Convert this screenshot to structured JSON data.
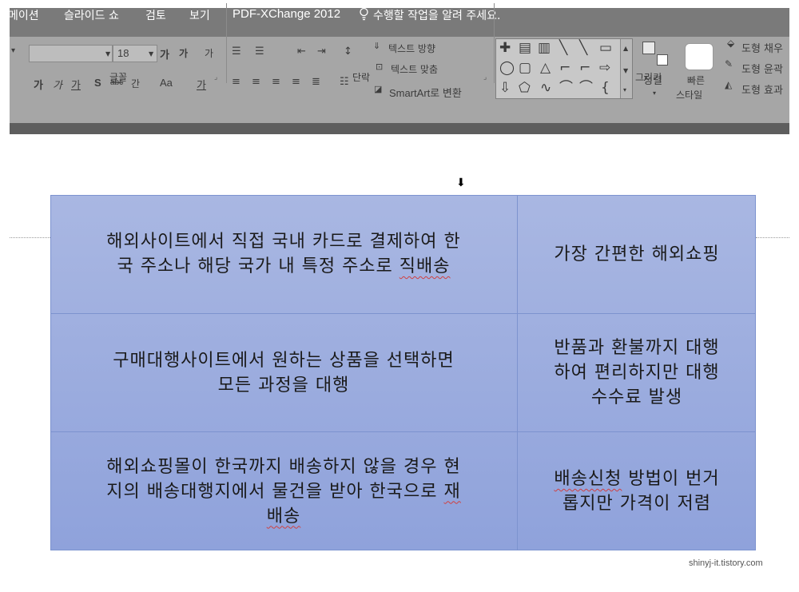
{
  "menu": {
    "tabs": [
      {
        "label": "메이션"
      },
      {
        "label": "슬라이드 쇼"
      },
      {
        "label": "검토"
      },
      {
        "label": "보기"
      },
      {
        "label": "PDF-XChange 2012"
      }
    ],
    "tellme": "수행할 작업을 알려 주세요."
  },
  "ribbon": {
    "font": {
      "size_value": "18",
      "bold_hint": "가",
      "italic": "가",
      "underline": "가",
      "shadow": "S",
      "strike": "abc",
      "spacing": "간",
      "case": "Aa",
      "color": "가",
      "grow": "가",
      "shrink": "가",
      "clear": "가",
      "group_label": "글꼴"
    },
    "paragraph": {
      "text_direction": "텍스트 방향",
      "align_text": "텍스트 맞춤",
      "smartart": "SmartArt로 변환",
      "group_label": "단락"
    },
    "drawing": {
      "arrange": "정렬",
      "quick_styles_1": "빠른",
      "quick_styles_2": "스타일",
      "shape_fill": "도형 채우",
      "shape_outline": "도형 윤곽",
      "shape_effects": "도형 효과",
      "group_label": "그리기"
    }
  },
  "table": {
    "rows": [
      {
        "left": "해외사이트에서 직접 국내 카드로 결제하여 한국 주소나 해당 국가 내 특정 주소로 직배송",
        "right": "가장 간편한 해외쇼핑"
      },
      {
        "left": "구매대행사이트에서 원하는 상품을 선택하면 모든 과정을 대행",
        "right": "반품과 환불까지 대행하여 편리하지만 대행 수수료 발생"
      },
      {
        "left": "해외쇼핑몰이 한국까지 배송하지 않을 경우 현지의 배송대행지에서 물건을 받아 한국으로 재배송",
        "right": "배송신청 방법이 번거롭지만 가격이 저렴"
      }
    ],
    "row0_left_line1": "해외사이트에서 직접 국내 카드로 결제하여 한",
    "row0_left_line2a": "국 주소나 해당 국가 내 특정 주소로 ",
    "row0_left_line2b": "직배송",
    "row1_left_line1": "구매대행사이트에서 원하는 상품을 선택하면",
    "row1_left_line2": "모든 과정을 대행",
    "row1_right_line1": "반품과 환불까지 대행",
    "row1_right_line2": "하여 편리하지만 대행",
    "row1_right_line3": "수수료 발생",
    "row2_left_line1": "해외쇼핑몰이 한국까지 배송하지 않을 경우 현",
    "row2_left_line2a": "지의 배송대행지에서 물건을 받아 한국으로 ",
    "row2_left_line2b": "재",
    "row2_left_line3": "배송",
    "row2_right_line1a": "배송신청",
    "row2_right_line1b": " 방법이 번거",
    "row2_right_line2": "롭지만 가격이 저렴"
  },
  "watermark": "shinyj-it.tistory.com"
}
